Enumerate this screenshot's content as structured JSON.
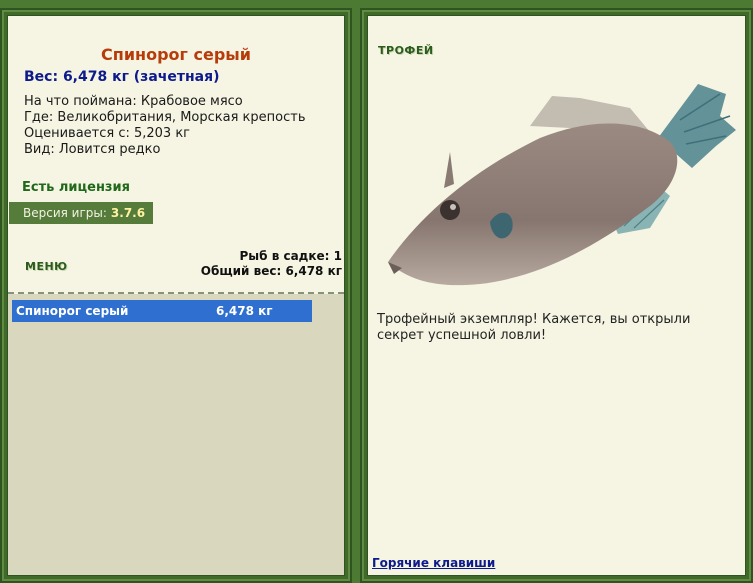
{
  "fish": {
    "name": "Спинорог серый",
    "weight_line": "Вес: 6,478 кг (зачетная)",
    "bait": "На что поймана: Крабовое мясо",
    "location": "Где: Великобритания, Морская крепость",
    "scored_from": "Оценивается с: 5,203 кг",
    "kind": "Вид: Ловится редко"
  },
  "license": "Есть лицензия",
  "version": {
    "label": "Версия игры:",
    "value": "3.7.6"
  },
  "menu_label": "МЕНЮ",
  "cage": {
    "count": "Рыб в садке: 1",
    "total": "Общий вес: 6,478 кг"
  },
  "catch_list": [
    {
      "name": "Спинорог серый",
      "weight": "6,478 кг"
    }
  ],
  "trophy": {
    "label": "ТРОФЕЙ",
    "text": "Трофейный экземпляр! Кажется, вы открыли секрет успешной ловли!"
  },
  "hotkeys_link": "Горячие клавиши",
  "colors": {
    "frame": "#3f6a2a",
    "panel": "#f6f5e3",
    "title": "#b63c0a",
    "weight": "#0d1a8c",
    "selection": "#2f6fd0"
  }
}
